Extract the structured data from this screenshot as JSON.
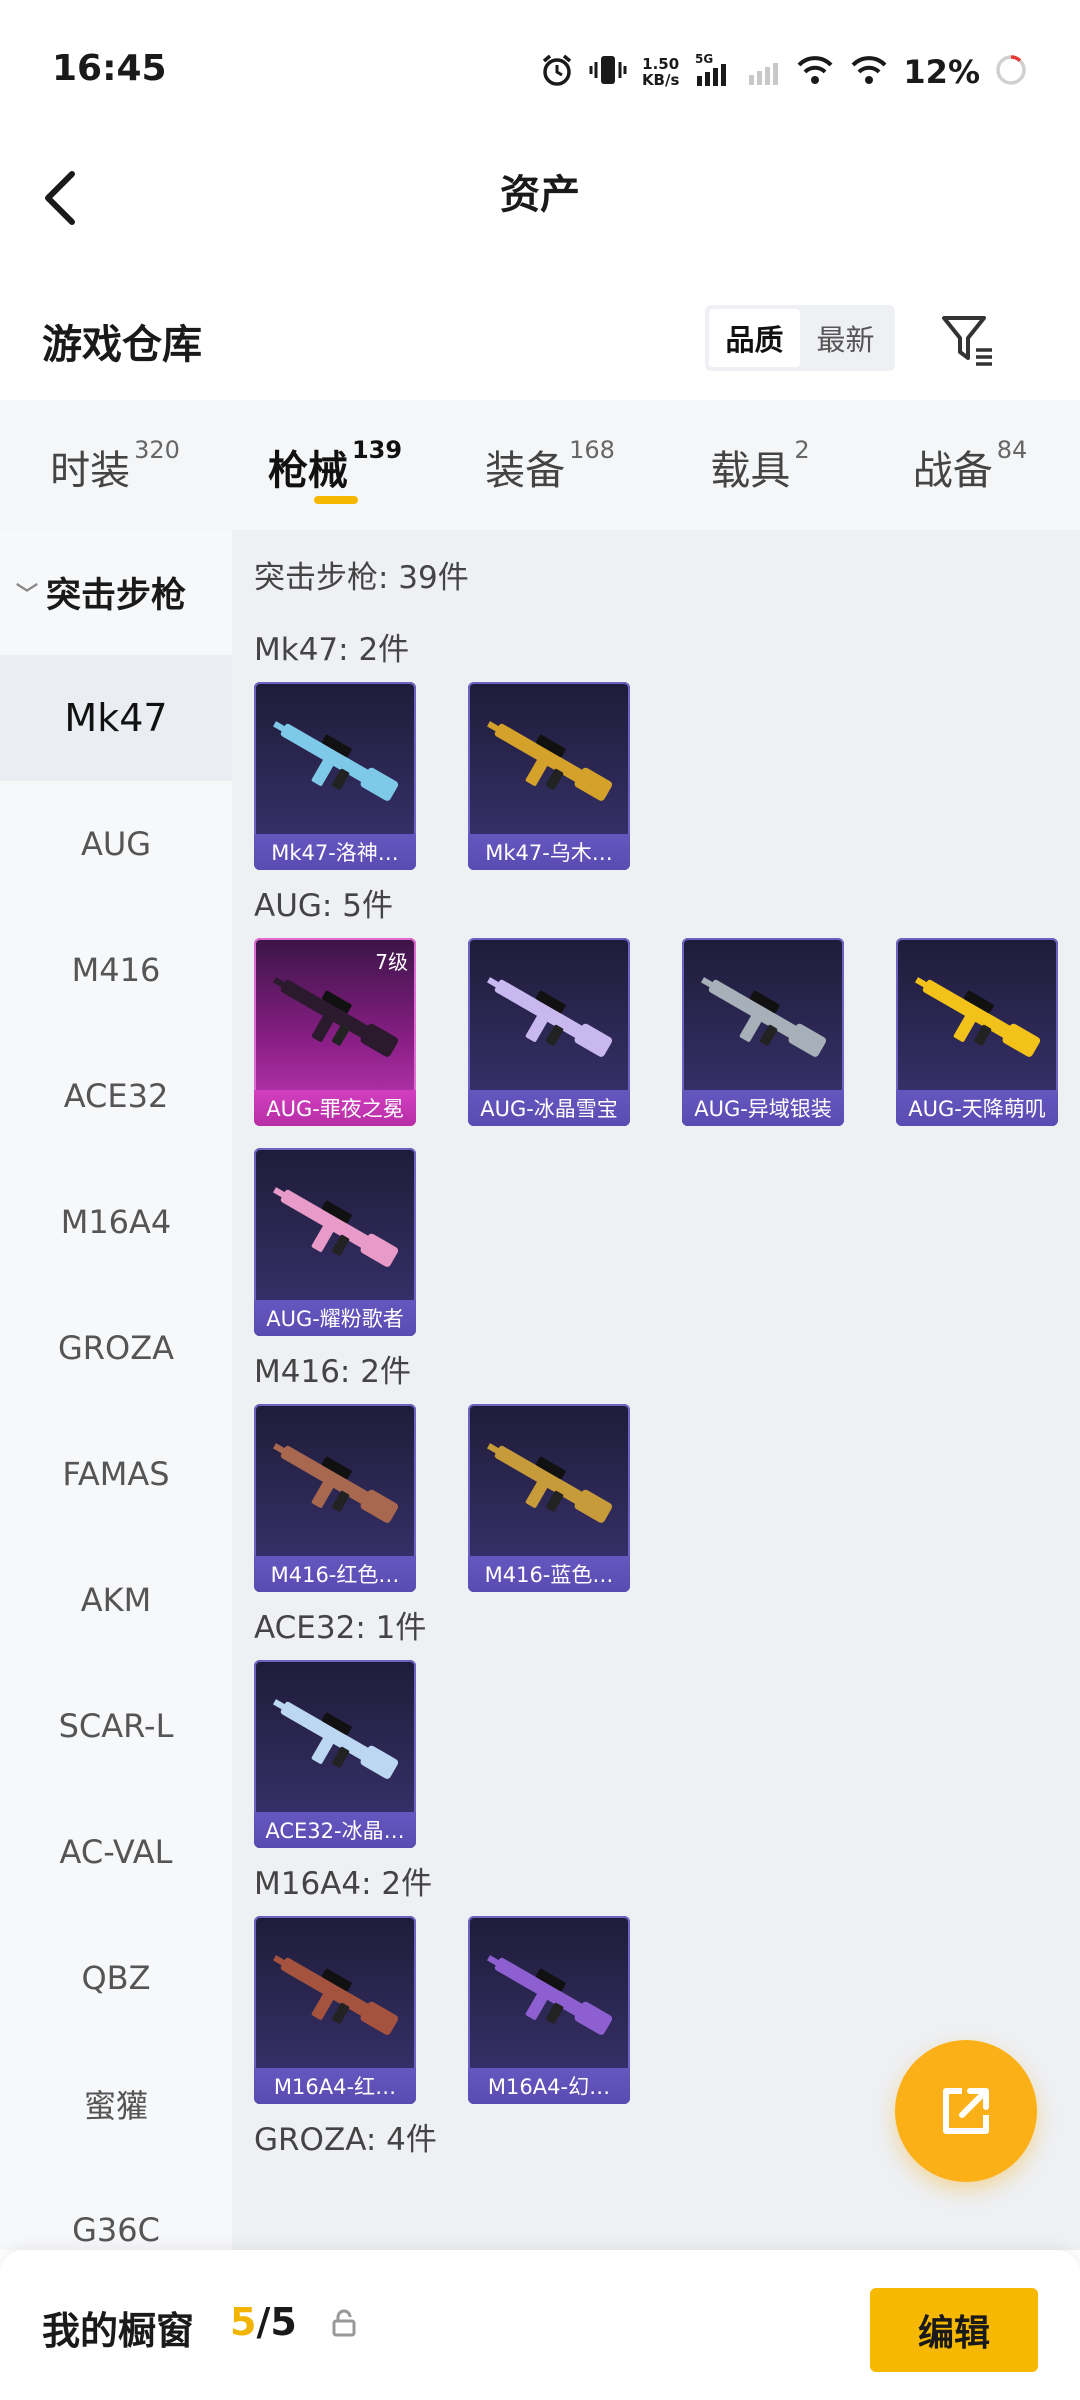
{
  "status_bar": {
    "time": "16:45",
    "speed_value": "1.50",
    "speed_unit": "KB/s",
    "network": "5G",
    "battery": "12%"
  },
  "header": {
    "title": "资产"
  },
  "warehouse": {
    "title": "游戏仓库",
    "sort_options": [
      "品质",
      "最新"
    ],
    "sort_selected": "品质"
  },
  "category_tabs": [
    {
      "label": "时装",
      "count": "320"
    },
    {
      "label": "枪械",
      "count": "139"
    },
    {
      "label": "装备",
      "count": "168"
    },
    {
      "label": "载具",
      "count": "2"
    },
    {
      "label": "战备",
      "count": "84"
    }
  ],
  "active_tab": "枪械",
  "sidebar": {
    "group": "突击步枪",
    "items": [
      "Mk47",
      "AUG",
      "M416",
      "ACE32",
      "M16A4",
      "GROZA",
      "FAMAS",
      "AKM",
      "SCAR-L",
      "AC-VAL",
      "QBZ",
      "蜜獾",
      "G36C"
    ],
    "active": "Mk47"
  },
  "content": {
    "total": "突击步枪: 39件",
    "sections": [
      {
        "title": "Mk47: 2件",
        "items": [
          {
            "name": "Mk47-洛神…",
            "style": "purple",
            "gun_color": "#7ec8e8"
          },
          {
            "name": "Mk47-乌木…",
            "style": "purple",
            "gun_color": "#d4a22a"
          }
        ]
      },
      {
        "title": "AUG: 5件",
        "items": [
          {
            "name": "AUG-罪夜之冕",
            "style": "pink",
            "level": "7级",
            "gun_color": "#2b1a2e"
          },
          {
            "name": "AUG-冰晶雪宝",
            "style": "purple",
            "gun_color": "#c9b8f0"
          },
          {
            "name": "AUG-异域银装",
            "style": "purple",
            "gun_color": "#a7b0b8"
          },
          {
            "name": "AUG-天降萌叽",
            "style": "purple",
            "gun_color": "#f2c21a"
          },
          {
            "name": "AUG-耀粉歌者",
            "style": "purple",
            "gun_color": "#e89ac8"
          }
        ]
      },
      {
        "title": "M416: 2件",
        "items": [
          {
            "name": "M416-红色…",
            "style": "purple",
            "gun_color": "#a8674f"
          },
          {
            "name": "M416-蓝色…",
            "style": "purple",
            "gun_color": "#c79a3a"
          }
        ]
      },
      {
        "title": "ACE32: 1件",
        "items": [
          {
            "name": "ACE32-冰晶…",
            "style": "purple",
            "gun_color": "#bcd7f2"
          }
        ]
      },
      {
        "title": "M16A4: 2件",
        "items": [
          {
            "name": "M16A4-红…",
            "style": "purple",
            "gun_color": "#a5533e"
          },
          {
            "name": "M16A4-幻…",
            "style": "purple",
            "gun_color": "#8e5fd0"
          }
        ]
      },
      {
        "title": "GROZA: 4件",
        "items": []
      }
    ]
  },
  "bottom_bar": {
    "label": "我的橱窗",
    "current": "5",
    "separator": "/",
    "max": "5",
    "edit_label": "编辑"
  },
  "colors": {
    "accent": "#f6b800",
    "card_purple": "#6657c0",
    "card_pink": "#d23fc0"
  },
  "icons": [
    "back-arrow-icon",
    "filter-icon",
    "share-icon",
    "lock-icon",
    "alarm-icon",
    "vibrate-icon",
    "signal-icon",
    "wifi-icon",
    "battery-ring-icon"
  ]
}
